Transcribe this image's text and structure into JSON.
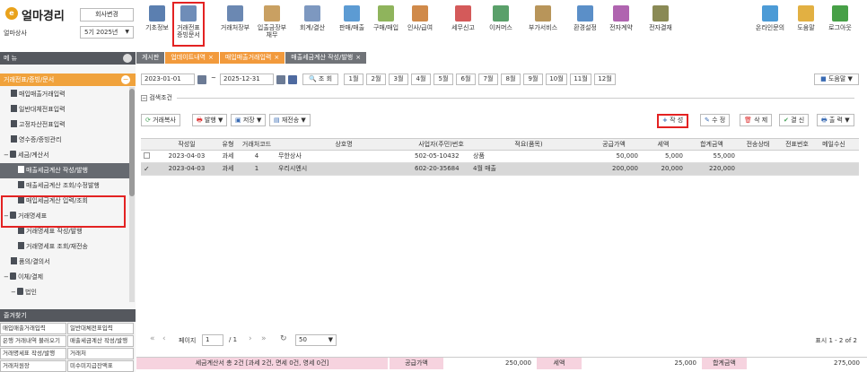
{
  "brand": {
    "logo_char": "e",
    "name": "얼마경리",
    "company": "얼마상사",
    "change_button": "회사변경",
    "year": "5기 2025년"
  },
  "toolbar": [
    {
      "label": "기초정보",
      "icon": "ledger-icon"
    },
    {
      "label": "거래전표\n증빙문서",
      "icon": "document-icon"
    },
    {
      "label": "거래처장부",
      "icon": "book-icon"
    },
    {
      "label": "입출금장부\n채무",
      "icon": "money-icon"
    },
    {
      "label": "회계/결산",
      "icon": "calc-icon"
    },
    {
      "label": "판매/매출",
      "icon": "sales-icon"
    },
    {
      "label": "구매/매입",
      "icon": "purchase-icon"
    },
    {
      "label": "인사/급여",
      "icon": "person-icon"
    },
    {
      "label": "세무신고",
      "icon": "tax-icon"
    },
    {
      "label": "이커머스",
      "icon": "store-icon"
    },
    {
      "label": "부가서비스",
      "icon": "bank-icon"
    },
    {
      "label": "환경설정",
      "icon": "gear-icon"
    },
    {
      "label": "전자계약",
      "icon": "sign-icon"
    },
    {
      "label": "전자결재",
      "icon": "approval-icon"
    },
    {
      "label": "온라인문의",
      "icon": "chat-icon"
    },
    {
      "label": "도움말",
      "icon": "help-icon"
    },
    {
      "label": "로그아웃",
      "icon": "logout-icon"
    }
  ],
  "left_panel": {
    "menu_header": "메 뉴",
    "section_title": "거래전표/증빙/문서",
    "items": [
      {
        "label": "매입매출거래입력",
        "type": "file",
        "indent": 1
      },
      {
        "label": "일반대체전표입력",
        "type": "file",
        "indent": 1
      },
      {
        "label": "고정자산전표입력",
        "type": "file",
        "indent": 1
      },
      {
        "label": "영수증/증빙관리",
        "type": "file",
        "indent": 1
      },
      {
        "label": "세금/계산서",
        "type": "folder",
        "indent": 0
      },
      {
        "label": "매출세금계산 작성/발행",
        "type": "file",
        "indent": 2,
        "selected": true
      },
      {
        "label": "매출세금계산 조회/수정발행",
        "type": "file",
        "indent": 2
      },
      {
        "label": "매입세금계산 입력/조회",
        "type": "file",
        "indent": 2
      },
      {
        "label": "거래명세표",
        "type": "folder",
        "indent": 0
      },
      {
        "label": "거래명세표 작성/발행",
        "type": "file",
        "indent": 2
      },
      {
        "label": "거래명세표 조회/재전송",
        "type": "file",
        "indent": 2
      },
      {
        "label": "품의/결의서",
        "type": "file",
        "indent": 1
      },
      {
        "label": "이체/결제",
        "type": "folder",
        "indent": 0
      },
      {
        "label": "법인",
        "type": "folder",
        "indent": 1
      },
      {
        "label": "국민은행(수수료 무료)",
        "type": "folder",
        "indent": 2
      }
    ],
    "favorites_header": "즐겨찾기",
    "favorites": [
      "매입매출거래입력",
      "일반대체전표입력",
      "은행 거래내역 불러오기",
      "매출세금계산 작성/발행",
      "거래명세표 작성/발행",
      "거래처",
      "거래처원장",
      "미수미지급잔액표"
    ]
  },
  "tabs": [
    {
      "label": "게시판",
      "style": "gray"
    },
    {
      "label": "업데이트내역",
      "style": "orange"
    },
    {
      "label": "매입매출거래입력",
      "style": "orange"
    },
    {
      "label": "매출세금계산 작성/발행",
      "style": "active"
    }
  ],
  "filter": {
    "date_from": "2023-01-01",
    "tilde": "~",
    "date_to": "2025-12-31",
    "search_button": "조 회",
    "months": [
      "1월",
      "2월",
      "3월",
      "4월",
      "5월",
      "6월",
      "7월",
      "8월",
      "9월",
      "10월",
      "11월",
      "12월"
    ],
    "help_button": "도움말",
    "search_conditions": "검색조건"
  },
  "actions": {
    "copy": "거래복사",
    "issue": "발행",
    "save": "저장",
    "resend": "재전송",
    "create": "작 성",
    "edit": "수 정",
    "delete": "삭 제",
    "approve": "결 신",
    "print": "출 력"
  },
  "grid": {
    "headers": [
      "작성일",
      "유형",
      "거래처코드",
      "상호명",
      "사업자(주민)번호",
      "적요(품목)",
      "공급가액",
      "세액",
      "합계금액",
      "전송상태",
      "전표번호",
      "메일수신"
    ],
    "rows": [
      [
        "2023-04-03",
        "과세",
        "4",
        "무한상사",
        "502-05-10432",
        "상품",
        "50,000",
        "5,000",
        "55,000",
        "",
        "",
        ""
      ],
      [
        "2023-04-03",
        "과세",
        "1",
        "우리시엔시",
        "602-20-35684",
        "4월 매출",
        "200,000",
        "20,000",
        "220,000",
        "",
        "",
        ""
      ]
    ]
  },
  "pager": {
    "page_label": "페이지",
    "page": "1",
    "total": "/ 1",
    "per_page": "50",
    "count_text": "표시 1 - 2 of 2"
  },
  "summary": {
    "text": "세금계산서 총 2건 [과세 2건, 면세 0건, 영세 0건]",
    "supply_label": "공급가액",
    "supply": "250,000",
    "tax_label": "세액",
    "tax": "25,000",
    "total_label": "합계금액",
    "total": "275,000"
  },
  "colors": {
    "accent": "#f0a23c",
    "highlight": "#e32222",
    "selected_menu": "#666a70"
  }
}
